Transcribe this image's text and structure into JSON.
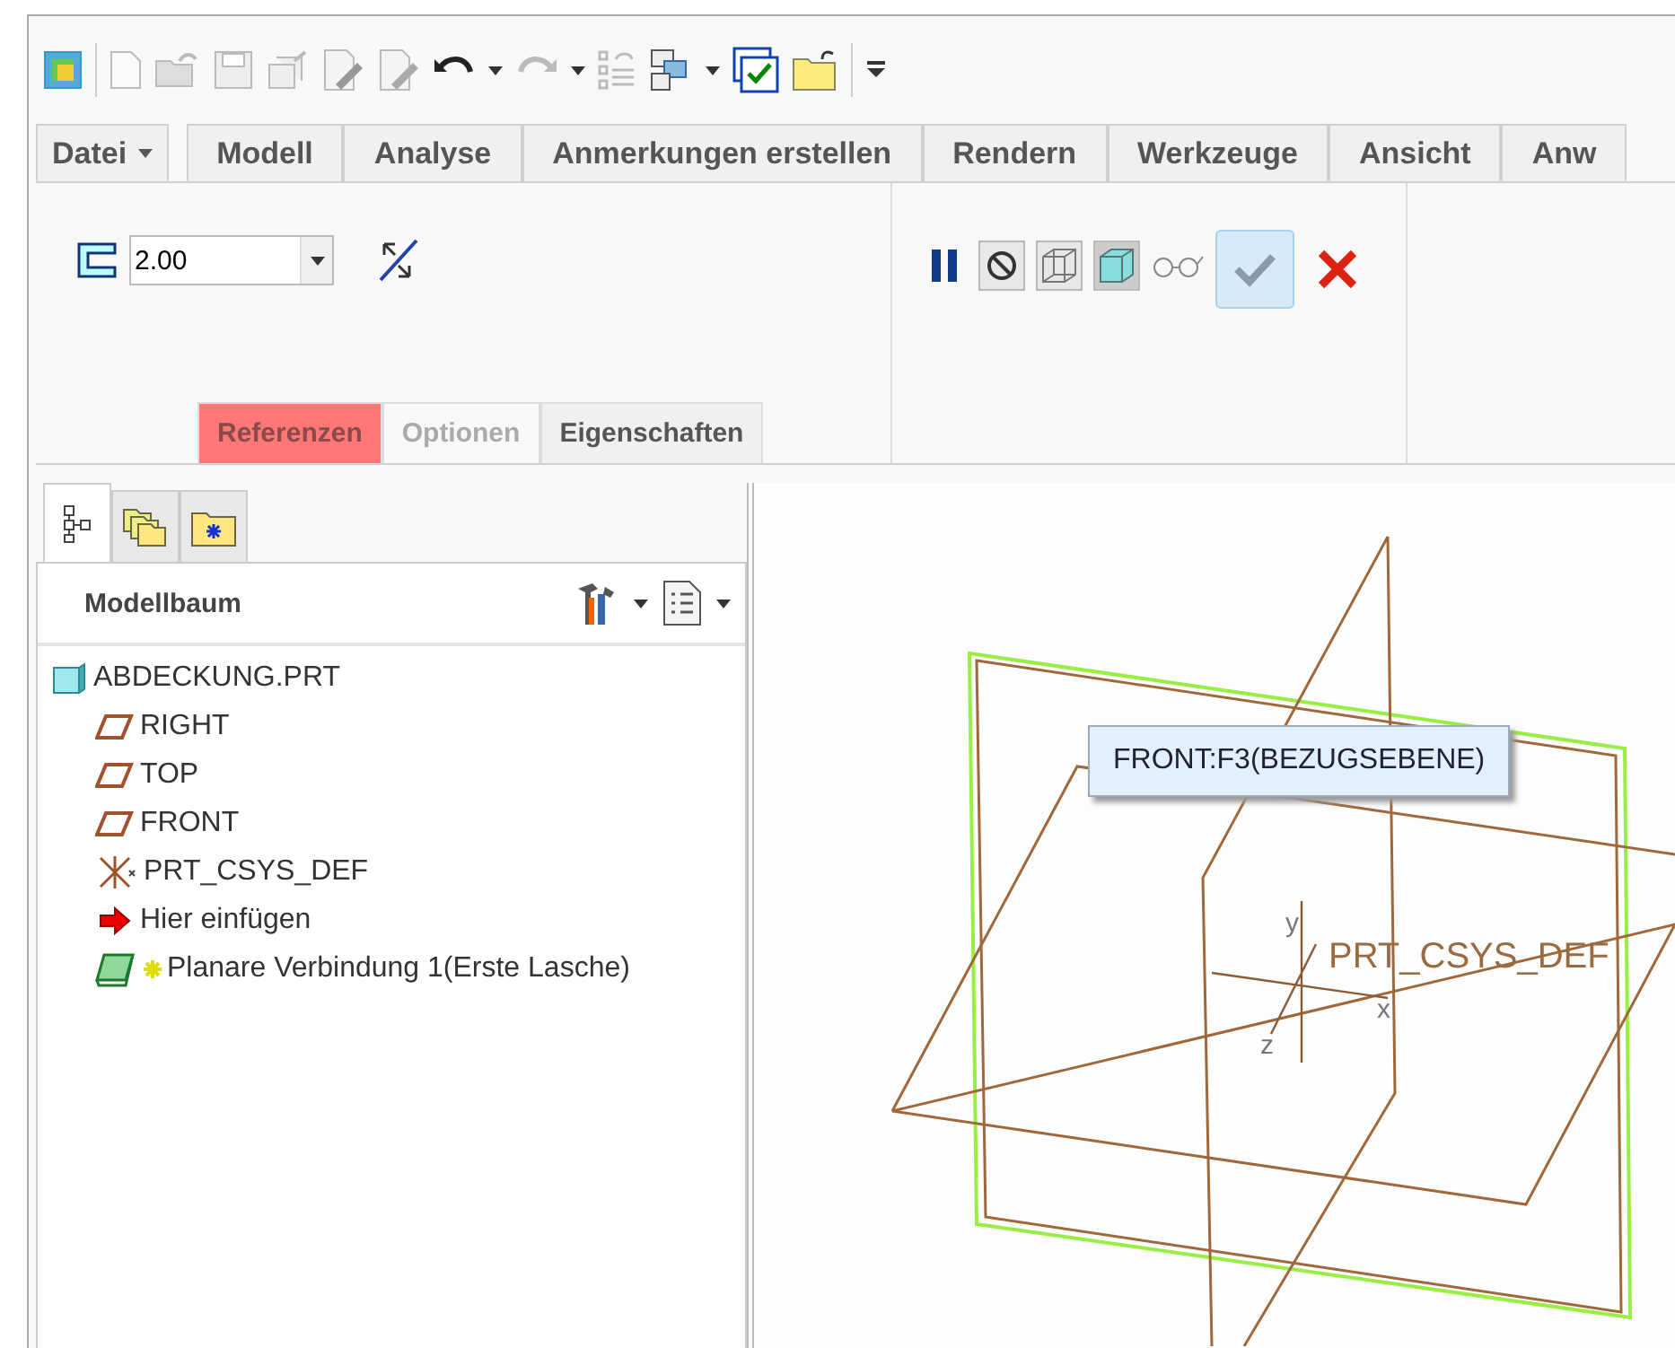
{
  "ribbon": {
    "tabs": [
      {
        "label": "Datei",
        "kind": "menu",
        "selected": false
      },
      {
        "label": "Modell",
        "kind": "tab",
        "selected": false
      },
      {
        "label": "Analyse",
        "kind": "tab",
        "selected": false
      },
      {
        "label": "Anmerkungen erstellen",
        "kind": "tab",
        "selected": false
      },
      {
        "label": "Rendern",
        "kind": "tab",
        "selected": false
      },
      {
        "label": "Werkzeuge",
        "kind": "tab",
        "selected": false
      },
      {
        "label": "Ansicht",
        "kind": "tab",
        "selected": false
      },
      {
        "label": "Anw",
        "kind": "tab",
        "selected": false
      }
    ],
    "thickness": {
      "value": "2.00"
    },
    "panels": [
      {
        "label": "Referenzen",
        "attention": true,
        "disabled": false
      },
      {
        "label": "Optionen",
        "attention": false,
        "disabled": true
      },
      {
        "label": "Eigenschaften",
        "attention": false,
        "disabled": false
      }
    ]
  },
  "navigator": {
    "tabs": [
      {
        "kind": "tree",
        "selected": true
      },
      {
        "kind": "folders",
        "selected": false
      },
      {
        "kind": "favorites",
        "selected": false
      }
    ],
    "title": "Modellbaum",
    "tree": [
      {
        "label": "ABDECKUNG.PRT",
        "kind": "part",
        "new": false,
        "children": [
          {
            "label": "RIGHT",
            "kind": "plane",
            "new": false
          },
          {
            "label": "TOP",
            "kind": "plane",
            "new": false
          },
          {
            "label": "FRONT",
            "kind": "plane",
            "new": false
          },
          {
            "label": "PRT_CSYS_DEF",
            "kind": "csys",
            "new": false
          },
          {
            "label": "Hier einfügen",
            "kind": "insert",
            "new": false
          },
          {
            "label": "Planare Verbindung 1(Erste Lasche)",
            "kind": "feature",
            "new": true
          }
        ]
      }
    ]
  },
  "viewport": {
    "axis_labels": [
      "y",
      "z",
      "x"
    ],
    "csys_label": "PRT_CSYS_DEF",
    "tooltip": "FRONT:F3(BEZUGSEBENE)"
  }
}
